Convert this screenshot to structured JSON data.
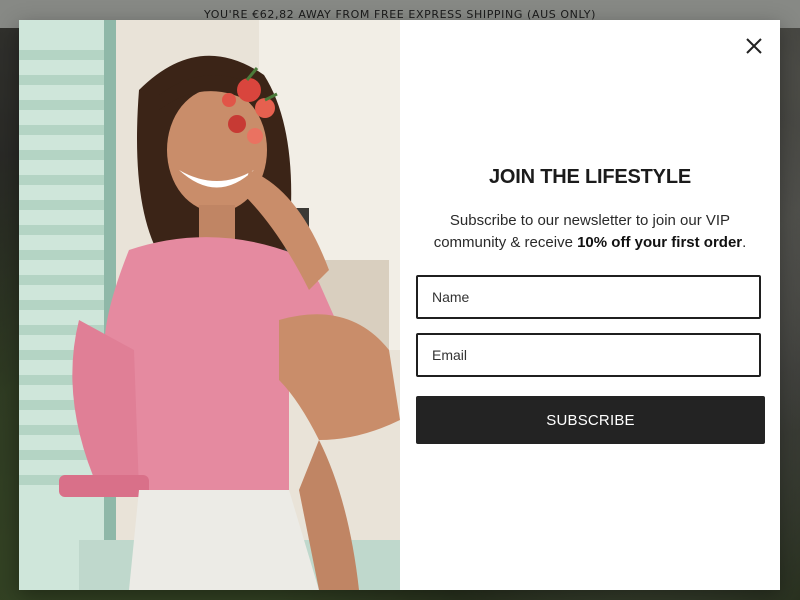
{
  "announcement": {
    "text": "YOU'RE €62,82 AWAY FROM FREE EXPRESS SHIPPING (AUS ONLY)"
  },
  "popup": {
    "title": "JOIN THE LIFESTYLE",
    "desc_part1": "Subscribe to our newsletter to join our VIP community & receive ",
    "desc_bold": "10% off your first order",
    "desc_part2": ".",
    "name_placeholder": "Name",
    "email_placeholder": "Email",
    "subscribe_label": "SUBSCRIBE",
    "close_icon": "close-icon",
    "image": "woman-pink-blouse-photo"
  },
  "colors": {
    "button_bg": "#232323",
    "announcement_bg": "#cfd3cc",
    "blouse": "#e58aa0"
  }
}
